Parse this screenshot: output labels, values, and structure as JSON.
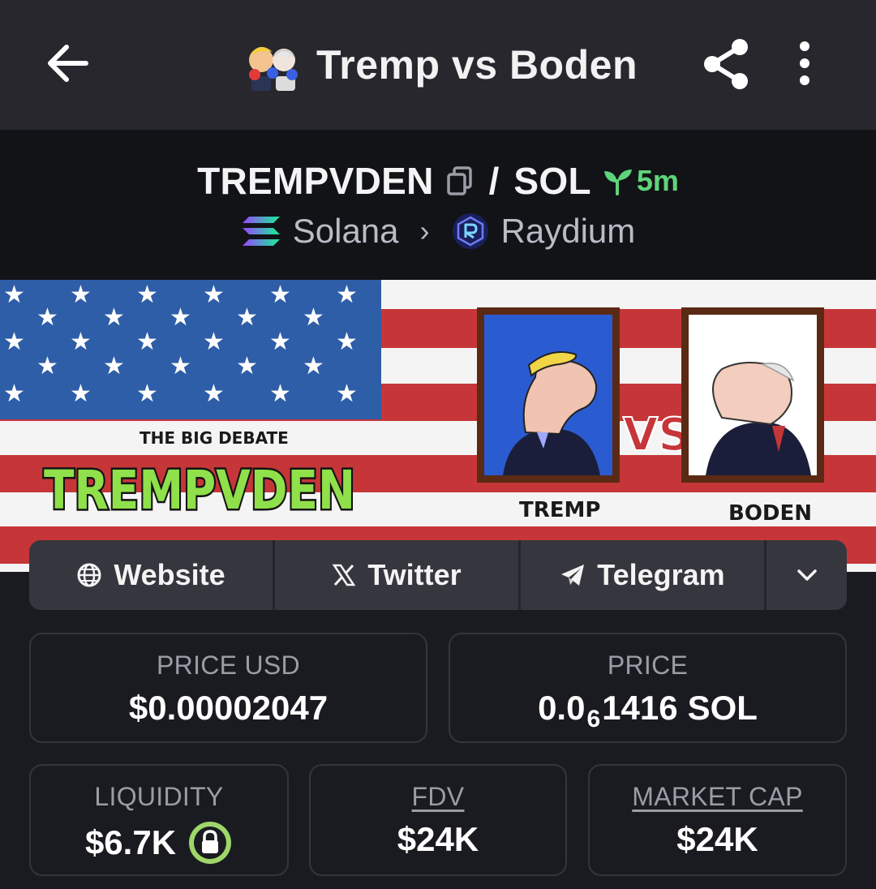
{
  "app_bar": {
    "title": "Tremp vs Boden",
    "icons": [
      "back-arrow-icon",
      "token-avatar",
      "share-icon",
      "more-vert-icon"
    ]
  },
  "pair": {
    "base_symbol": "TREMPVDEN",
    "separator": "/",
    "quote_symbol": "SOL",
    "age": "5m",
    "chain": "Solana",
    "dex": "Raydium",
    "colors": {
      "age_green": "#5fd47a",
      "muted": "#b9bcc6"
    }
  },
  "banner": {
    "subtitle": "THE BIG DEBATE",
    "headline": "TREMPVDEN",
    "vs_text": "VS",
    "left_name": "TREMP",
    "right_name": "BODEN"
  },
  "links": [
    {
      "label": "Website",
      "icon": "globe-icon"
    },
    {
      "label": "Twitter",
      "icon": "x-logo-icon"
    },
    {
      "label": "Telegram",
      "icon": "telegram-icon"
    },
    {
      "label": "",
      "icon": "chevron-down-icon"
    }
  ],
  "stats": {
    "price_usd": {
      "label": "PRICE USD",
      "value": "$0.00002047"
    },
    "price_native": {
      "label": "PRICE",
      "prefix": "0.0",
      "zeros": "6",
      "digits": "1416",
      "unit": "SOL"
    },
    "liquidity": {
      "label": "LIQUIDITY",
      "value": "$6.7K"
    },
    "fdv": {
      "label": "FDV",
      "value": "$24K"
    },
    "market_cap": {
      "label": "MARKET CAP",
      "value": "$24K"
    }
  }
}
